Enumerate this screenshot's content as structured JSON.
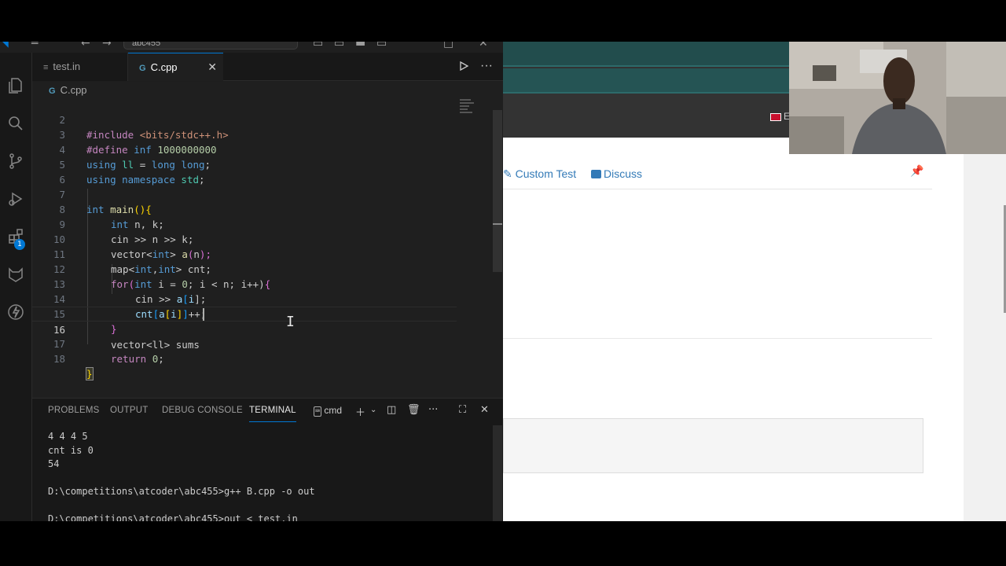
{
  "vscode": {
    "title_search": "abc455",
    "tabs": [
      {
        "label": "test.in",
        "icon": "file-lines-icon"
      },
      {
        "label": "C.cpp",
        "icon": "cpp-file-icon",
        "active": true
      }
    ],
    "breadcrumb": "C.cpp",
    "extensions_badge": "1",
    "editor": {
      "lines": [
        {
          "num": "2"
        },
        {
          "num": "3"
        },
        {
          "num": "4"
        },
        {
          "num": "5"
        },
        {
          "num": "6"
        },
        {
          "num": "7"
        },
        {
          "num": "8"
        },
        {
          "num": "9"
        },
        {
          "num": "10"
        },
        {
          "num": "11"
        },
        {
          "num": "12"
        },
        {
          "num": "13"
        },
        {
          "num": "14"
        },
        {
          "num": "15"
        },
        {
          "num": "16"
        },
        {
          "num": "17"
        },
        {
          "num": "18"
        }
      ],
      "code": {
        "l2": [
          "#include ",
          "<bits/stdc++.h>"
        ],
        "l3": [
          "#define ",
          "inf ",
          "1000000000"
        ],
        "l4": [
          "using ",
          "ll",
          " = ",
          "long long",
          ";"
        ],
        "l5": [
          "using ",
          "namespace ",
          "std",
          ";"
        ],
        "l7": [
          "int ",
          "main",
          "()",
          "{"
        ],
        "l8": [
          "int ",
          "n, k;"
        ],
        "l9": [
          "cin >> n >> k;"
        ],
        "l10": [
          "vector",
          "<",
          "int",
          "> ",
          "a",
          "(",
          "n",
          ");"
        ],
        "l11": [
          "map",
          "<",
          "int",
          ",",
          "int",
          "> cnt;"
        ],
        "l12": [
          "for",
          "(",
          "int ",
          "i = ",
          "0",
          "; i < n; i++)",
          "{"
        ],
        "l13": [
          "cin >> ",
          "a",
          "[",
          "i",
          "];"
        ],
        "l14": [
          "cnt",
          "[",
          "a",
          "[",
          "i",
          "]",
          "]",
          "++;"
        ],
        "l15": [
          "}"
        ],
        "l16": [
          "vector<ll> sums"
        ],
        "l17": [
          "return ",
          "0",
          ";"
        ],
        "l18": [
          "}"
        ]
      }
    },
    "panel": {
      "tabs": [
        "PROBLEMS",
        "OUTPUT",
        "DEBUG CONSOLE",
        "TERMINAL"
      ],
      "terminal_name": "cmd",
      "terminal_lines": [
        "4 4 4 5",
        "cnt is 0",
        "54",
        "",
        "D:\\competitions\\atcoder\\abc455>g++ B.cpp -o out",
        "",
        "D:\\competitions\\atcoder\\abc455>out < test.in"
      ]
    }
  },
  "browser": {
    "nav": {
      "custom_test": "Custom Test",
      "discuss": "Discuss"
    },
    "lang_letter": "E"
  },
  "colors": {
    "editor_bg": "#1f1f1f",
    "accent": "#0078d4",
    "link": "#337ab7"
  }
}
